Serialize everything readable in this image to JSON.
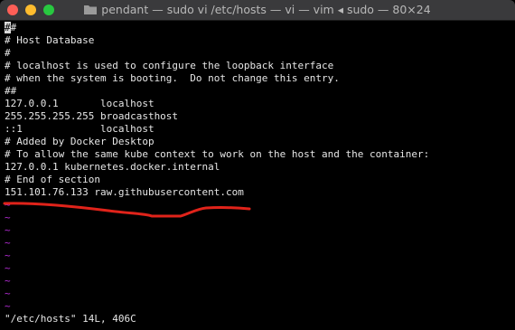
{
  "window": {
    "title": "pendant — sudo vi /etc/hosts — vi — vim ◂ sudo — 80×24",
    "icon": "folder-icon"
  },
  "buffer": {
    "cursor_char": "#",
    "lines": [
      "#",
      "# Host Database",
      "#",
      "# localhost is used to configure the loopback interface",
      "# when the system is booting.  Do not change this entry.",
      "##",
      "127.0.0.1       localhost",
      "255.255.255.255 broadcasthost",
      "::1             localhost",
      "# Added by Docker Desktop",
      "# To allow the same kube context to work on the host and the container:",
      "127.0.0.1 kubernetes.docker.internal",
      "# End of section",
      "151.101.76.133 raw.githubusercontent.com"
    ],
    "empty_lines": [
      "~",
      "~",
      "~",
      "~",
      "~",
      "~",
      "~",
      "~",
      "~"
    ]
  },
  "statusline": {
    "text": "\"/etc/hosts\" 14L, 406C"
  },
  "colors": {
    "tilde": "#b52cd6",
    "annotation": "#e0231a"
  }
}
